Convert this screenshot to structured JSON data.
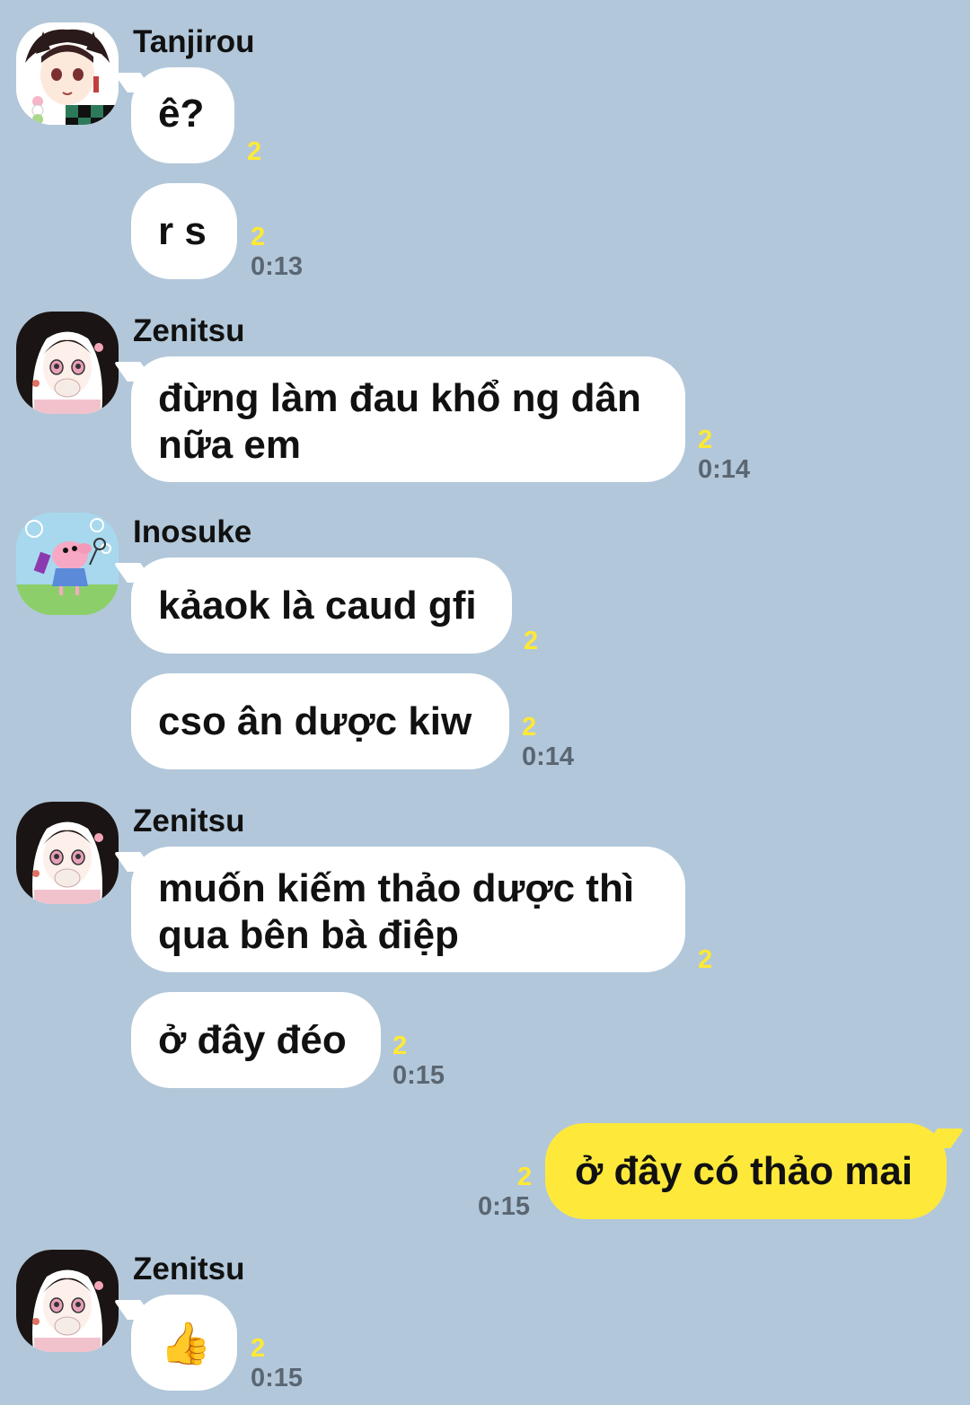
{
  "colors": {
    "background": "#b2c7da",
    "incoming_bubble": "#ffffff",
    "outgoing_bubble": "#fee93b",
    "unread_count": "#ffe933",
    "timestamp": "#5a6672"
  },
  "groups": [
    {
      "sender": "Tanjirou",
      "avatar_icon": "tanjirou-avatar-icon",
      "messages": [
        {
          "text": "ê?",
          "unread": "2",
          "time": ""
        },
        {
          "text": "r s",
          "unread": "2",
          "time": "0:13"
        }
      ]
    },
    {
      "sender": "Zenitsu",
      "avatar_icon": "nezuko-avatar-icon",
      "messages": [
        {
          "line1": "đừng làm đau khổ ng dân",
          "line2": "nữa em",
          "unread": "2",
          "time": "0:14"
        }
      ]
    },
    {
      "sender": "Inosuke",
      "avatar_icon": "peppa-pig-avatar-icon",
      "messages": [
        {
          "text": "kảaok là caud gfi",
          "unread": "2",
          "time": ""
        },
        {
          "text": "cso ân dược kiw",
          "unread": "2",
          "time": "0:14"
        }
      ]
    },
    {
      "sender": "Zenitsu",
      "avatar_icon": "nezuko-avatar-icon",
      "messages": [
        {
          "line1": "muốn kiếm thảo dược thì",
          "line2": "qua bên bà điệp",
          "unread": "2",
          "time": ""
        },
        {
          "text": "ở đây đéo",
          "unread": "2",
          "time": "0:15"
        }
      ]
    },
    {
      "sender": "me",
      "messages": [
        {
          "text": "ở đây có thảo mai",
          "unread": "2",
          "time": "0:15"
        }
      ]
    },
    {
      "sender": "Zenitsu",
      "avatar_icon": "nezuko-avatar-icon",
      "messages": [
        {
          "emoji": "👍",
          "emoji_name": "thumbs-up-icon",
          "unread": "2",
          "time": "0:15"
        }
      ]
    }
  ]
}
